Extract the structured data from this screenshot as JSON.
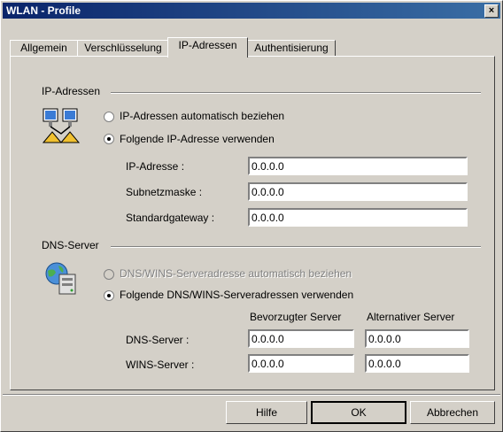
{
  "window": {
    "title": "WLAN - Profile",
    "close_glyph": "×"
  },
  "tabs": [
    {
      "label": "Allgemein"
    },
    {
      "label": "Verschlüsselung"
    },
    {
      "label": "IP-Adressen",
      "active": true
    },
    {
      "label": "Authentisierung"
    }
  ],
  "ip_group": {
    "label": "IP-Adressen",
    "icon": "network-computers-icon",
    "auto_label": "IP-Adressen automatisch beziehen",
    "manual_label": "Folgende IP-Adresse verwenden",
    "ip_label": "IP-Adresse :",
    "ip_value": "0.0.0.0",
    "mask_label": "Subnetzmaske :",
    "mask_value": "0.0.0.0",
    "gateway_label": "Standardgateway :",
    "gateway_value": "0.0.0.0"
  },
  "dns_group": {
    "label": "DNS-Server",
    "icon": "server-globe-icon",
    "auto_label": "DNS/WINS-Serveradresse automatisch beziehen",
    "manual_label": "Folgende DNS/WINS-Serveradressen verwenden",
    "preferred_header": "Bevorzugter Server",
    "alternate_header": "Alternativer Server",
    "dns_label": "DNS-Server :",
    "dns_preferred": "0.0.0.0",
    "dns_alternate": "0.0.0.0",
    "wins_label": "WINS-Server :",
    "wins_preferred": "0.0.0.0",
    "wins_alternate": "0.0.0.0"
  },
  "buttons": {
    "help": "Hilfe",
    "ok": "OK",
    "cancel": "Abbrechen"
  }
}
